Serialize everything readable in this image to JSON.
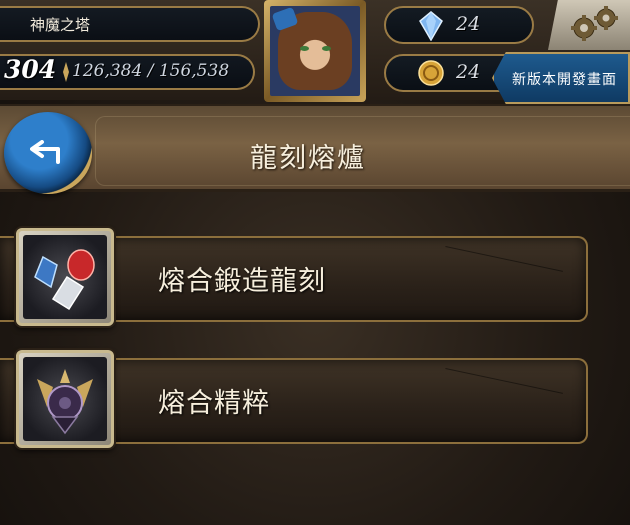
{
  "header": {
    "location": "神魔之塔",
    "level": "304",
    "experience": "126,384 / 156,538",
    "diamonds": "24",
    "coins": "24",
    "news_button": "新版本開發畫面"
  },
  "page": {
    "title": "龍刻熔爐"
  },
  "menu": {
    "items": [
      {
        "label": "熔合鍛造龍刻",
        "icon": "gem-fusion-icon"
      },
      {
        "label": "熔合精粹",
        "icon": "essence-emblem-icon"
      }
    ]
  },
  "colors": {
    "gold_trim": "#9a7b45",
    "button_blue": "#1e5a8e",
    "header_band": "#7a6244",
    "text_light": "#f6eedc"
  },
  "icons": {
    "back": "back-arrow-icon",
    "settings": "gear-icon",
    "diamond": "diamond-icon",
    "coin": "coin-icon"
  }
}
